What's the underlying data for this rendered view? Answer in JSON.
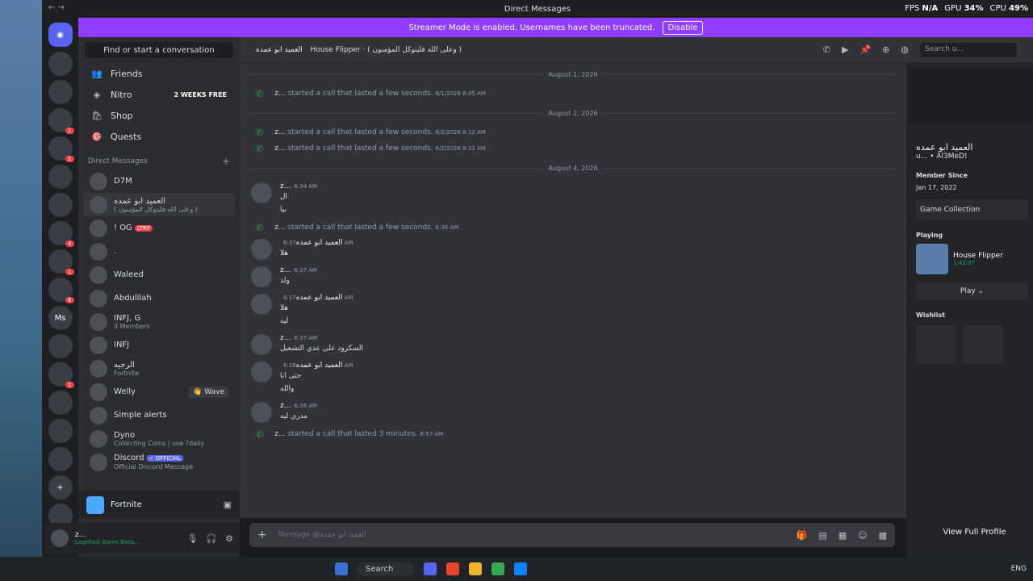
{
  "window": {
    "title": "Direct Messages",
    "stats": {
      "fps_label": "FPS",
      "fps": "N/A",
      "gpu_label": "GPU",
      "gpu": "34%",
      "cpu_label": "CPU",
      "cpu": "49%"
    }
  },
  "banner": {
    "text": "Streamer Mode is enabled. Usernames have been truncated.",
    "button": "Disable"
  },
  "servers": [
    {
      "label": "",
      "badge": ""
    },
    {
      "label": "",
      "badge": ""
    },
    {
      "label": "",
      "badge": "1"
    },
    {
      "label": "",
      "badge": "1"
    },
    {
      "label": "",
      "badge": ""
    },
    {
      "label": "",
      "badge": ""
    },
    {
      "label": "",
      "badge": "4"
    },
    {
      "label": "",
      "badge": "1"
    },
    {
      "label": "",
      "badge": "6"
    },
    {
      "label": "Ms",
      "badge": ""
    },
    {
      "label": "",
      "badge": ""
    },
    {
      "label": "",
      "badge": "1"
    },
    {
      "label": "",
      "badge": ""
    },
    {
      "label": "",
      "badge": ""
    },
    {
      "label": "",
      "badge": ""
    },
    {
      "label": "+",
      "badge": ""
    },
    {
      "label": "",
      "badge": ""
    }
  ],
  "sidebar": {
    "search_placeholder": "Find or start a conversation",
    "nav": [
      {
        "label": "Friends",
        "badge": ""
      },
      {
        "label": "Nitro",
        "badge": "2 WEEKS FREE"
      },
      {
        "label": "Shop",
        "badge": ""
      },
      {
        "label": "Quests",
        "badge": ""
      }
    ],
    "dm_header": "Direct Messages",
    "dm_add": "+",
    "dms": [
      {
        "name": "D7M",
        "sub": "",
        "tag": ""
      },
      {
        "name": "العميد ابو عمده",
        "sub": "( وعلى الله فليتوكل المؤمنون )",
        "tag": ""
      },
      {
        "name": "! OG",
        "sub": "",
        "tag": "LTRP"
      },
      {
        "name": ".",
        "sub": "",
        "tag": ""
      },
      {
        "name": "Waleed",
        "sub": "",
        "tag": ""
      },
      {
        "name": "Abdulilah",
        "sub": "",
        "tag": ""
      },
      {
        "name": "INFJ, G",
        "sub": "3 Members",
        "tag": ""
      },
      {
        "name": "INFJ",
        "sub": "",
        "tag": ""
      },
      {
        "name": "الرجيه",
        "sub": "Fortnite",
        "tag": ""
      },
      {
        "name": "Welly",
        "sub": "",
        "tag": "",
        "wave": "👋 Wave"
      },
      {
        "name": "Simple alerts",
        "sub": "",
        "tag": ""
      },
      {
        "name": "Dyno",
        "sub": "Collecting Coins | use ?daily",
        "tag": ""
      },
      {
        "name": "Discord",
        "sub": "Official Discord Message",
        "official": "✓ OFFICIAL"
      }
    ],
    "activity": "Fortnite",
    "user": {
      "name": "z...",
      "status": "LagoFast Game Boos..."
    }
  },
  "chat_header": {
    "recipient": "العميد ابو عمده",
    "status": "House Flipper · ( وعلى الله فليتوكل المؤمنون )",
    "search_placeholder": "Search u..."
  },
  "messages": [
    {
      "kind": "date",
      "text": "August 1, 2026"
    },
    {
      "kind": "call",
      "user": "z...",
      "text": "started a call that lasted a few seconds.",
      "time": "8/1/2026 6:45 AM"
    },
    {
      "kind": "date",
      "text": "August 2, 2026"
    },
    {
      "kind": "call",
      "user": "z...",
      "text": "started a call that lasted a few seconds.",
      "time": "8/2/2026 8:12 AM"
    },
    {
      "kind": "call",
      "user": "z...",
      "text": "started a call that lasted a few seconds.",
      "time": "8/2/2026 8:12 AM"
    },
    {
      "kind": "date",
      "text": "August 4, 2026"
    },
    {
      "kind": "msg",
      "user": "z...",
      "time": "6:34 AM",
      "lines": [
        "ال",
        "بيا"
      ]
    },
    {
      "kind": "call",
      "user": "z...",
      "text": "started a call that lasted a few seconds.",
      "time": "6:36 AM"
    },
    {
      "kind": "msg",
      "user": "العميد ابو عمده",
      "time": "6:37 AM",
      "lines": [
        "هلا"
      ]
    },
    {
      "kind": "msg",
      "user": "z...",
      "time": "6:37 AM",
      "lines": [
        "ولد"
      ]
    },
    {
      "kind": "msg",
      "user": "العميد ابو عمده",
      "time": "6:37 AM",
      "lines": [
        "هلا",
        "ليه"
      ]
    },
    {
      "kind": "msg",
      "user": "z...",
      "time": "6:37 AM",
      "lines": [
        "السكرود على عدي التشغيل"
      ]
    },
    {
      "kind": "msg",
      "user": "العميد ابو عمده",
      "time": "6:38 AM",
      "lines": [
        "حتى انا",
        "والله"
      ]
    },
    {
      "kind": "msg",
      "user": "z...",
      "time": "6:38 AM",
      "lines": [
        "مدري ليه"
      ]
    },
    {
      "kind": "call",
      "user": "z...",
      "text": "started a call that lasted 3 minutes.",
      "time": "8:57 AM"
    }
  ],
  "composer": {
    "placeholder": "Message @العميد ابو عمده"
  },
  "profile": {
    "name": "العميد ابو عمده",
    "sub": "u... • Al3MeD!",
    "member_since_label": "Member Since",
    "member_since": "Jan 17, 2022",
    "game_collection": "Game Collection",
    "playing_label": "Playing",
    "game_name": "House Flipper",
    "game_time": "1:42:07",
    "play_button": "Play",
    "wishlist_label": "Wishlist",
    "view_full": "View Full Profile"
  },
  "taskbar": {
    "search": "Search",
    "tray": "ENG"
  },
  "colors": {
    "accent": "#5865f2",
    "banner": "#8f3dff",
    "online": "#23a55a"
  }
}
